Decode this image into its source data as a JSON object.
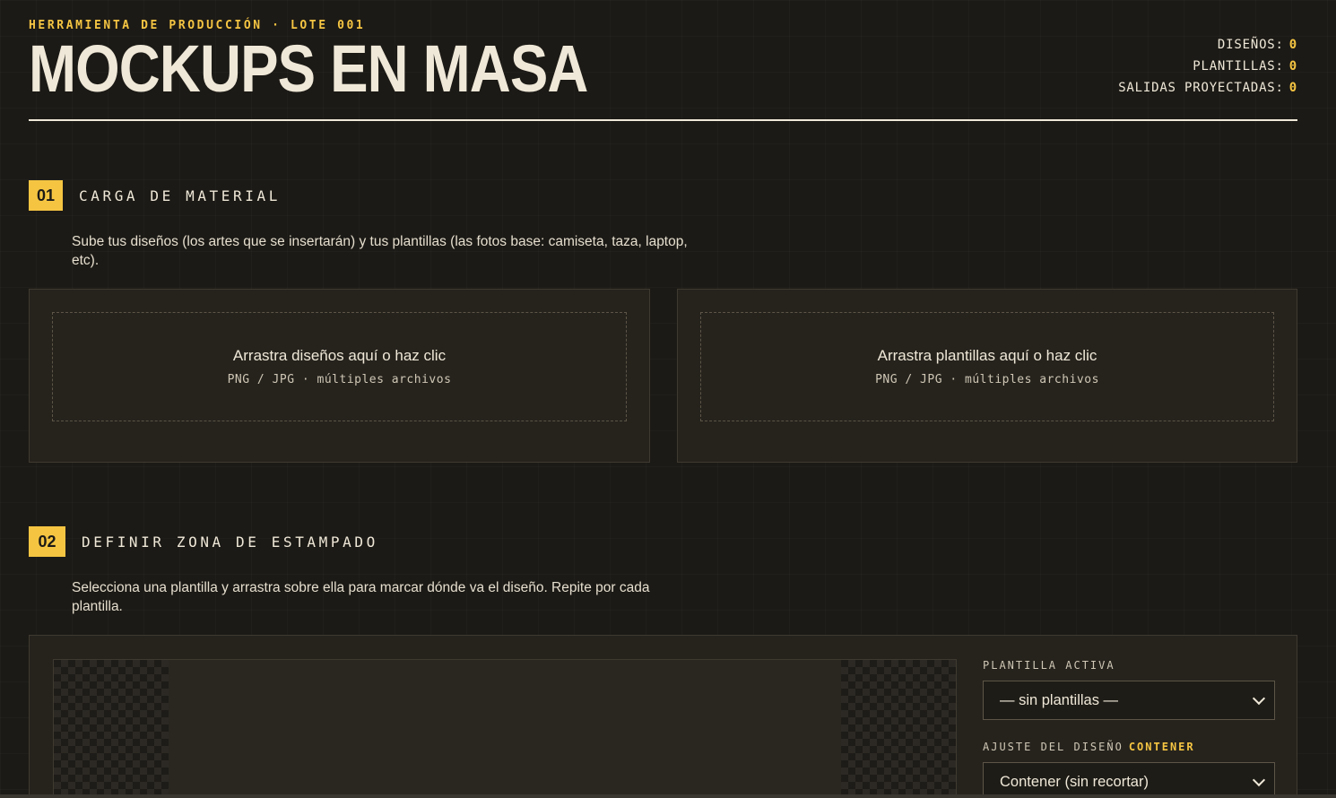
{
  "header": {
    "kicker": "HERRAMIENTA DE PRODUCCIÓN · LOTE 001",
    "title": "MOCKUPS EN MASA",
    "stats": [
      {
        "label": "DISEÑOS:",
        "value": "0"
      },
      {
        "label": "PLANTILLAS:",
        "value": "0"
      },
      {
        "label": "SALIDAS PROYECTADAS:",
        "value": "0"
      }
    ]
  },
  "section1": {
    "number": "01",
    "title": "CARGA DE MATERIAL",
    "description": "Sube tus diseños (los artes que se insertarán) y tus plantillas (las fotos base: camiseta, taza, laptop, etc).",
    "designs_drop": {
      "title": "Arrastra diseños aquí o haz clic",
      "subtitle": "PNG / JPG · múltiples archivos"
    },
    "templates_drop": {
      "title": "Arrastra plantillas aquí o haz clic",
      "subtitle": "PNG / JPG · múltiples archivos"
    }
  },
  "section2": {
    "number": "02",
    "title": "DEFINIR ZONA DE ESTAMPADO",
    "description": "Selecciona una plantilla y arrastra sobre ella para marcar dónde va el diseño. Repite por cada plantilla.",
    "active_template_label": "PLANTILLA ACTIVA",
    "active_template_value": "— sin plantillas —",
    "fit_label": "AJUSTE DEL DISEÑO",
    "fit_current": "CONTENER",
    "fit_value": "Contener (sin recortar)"
  },
  "colors": {
    "accent": "#f5c542",
    "background": "#1c1a16",
    "panel": "#26231d",
    "text": "#efe8d8"
  }
}
